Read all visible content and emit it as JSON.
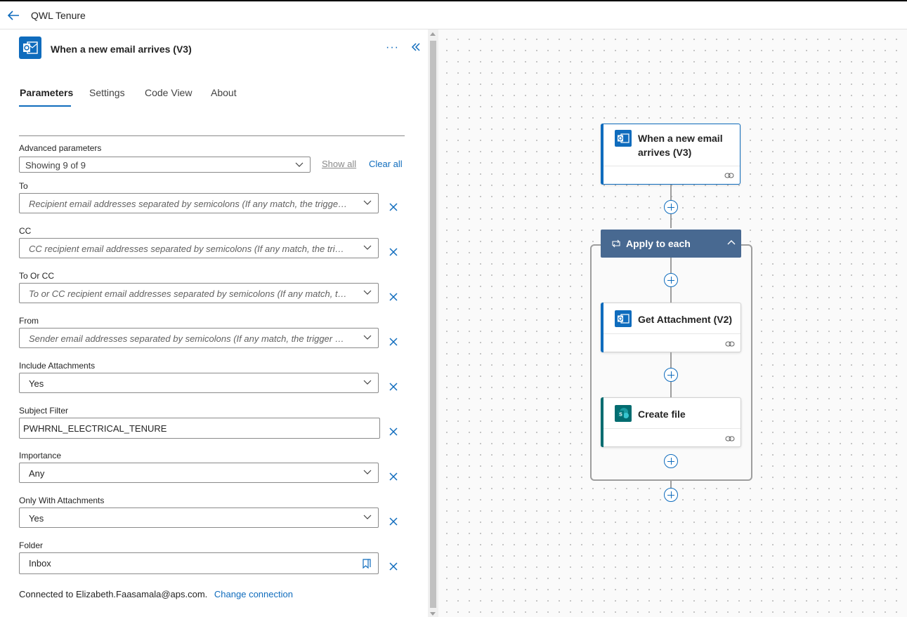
{
  "header": {
    "title": "QWL Tenure"
  },
  "panel": {
    "title": "When a new email arrives (V3)",
    "more": "···",
    "tabs": [
      {
        "label": "Parameters"
      },
      {
        "label": "Settings"
      },
      {
        "label": "Code View"
      },
      {
        "label": "About"
      }
    ],
    "advanced": {
      "label": "Advanced parameters",
      "value": "Showing 9 of 9",
      "show_all": "Show all",
      "clear_all": "Clear all"
    },
    "fields": [
      {
        "label": "To",
        "value": "Recipient email addresses separated by semicolons (If any match, the trigger will run)"
      },
      {
        "label": "CC",
        "value": "CC recipient email addresses separated by semicolons (If any match, the trigger will run)"
      },
      {
        "label": "To Or CC",
        "value": "To or CC recipient email addresses separated by semicolons (If any match, the trigger will run)"
      },
      {
        "label": "From",
        "value": "Sender email addresses separated by semicolons (If any match, the trigger will run)"
      },
      {
        "label": "Include Attachments",
        "value": "Yes"
      },
      {
        "label": "Subject Filter",
        "value": "PWHRNL_ELECTRICAL_TENURE"
      },
      {
        "label": "Importance",
        "value": "Any"
      },
      {
        "label": "Only With Attachments",
        "value": "Yes"
      },
      {
        "label": "Folder",
        "value": "Inbox"
      }
    ],
    "connection": {
      "text": "Connected to Elizabeth.Faasamala@aps.com.",
      "link": "Change connection"
    }
  },
  "flow": {
    "trigger": {
      "title_line1": "When a new email",
      "title_line2": "arrives (V3)"
    },
    "scope": {
      "title": "Apply to each"
    },
    "actions": [
      {
        "title": "Get Attachment (V2)"
      },
      {
        "title": "Create file"
      }
    ]
  },
  "colors": {
    "accent": "#0f6cbd",
    "outlook": "#0f6cbd",
    "sharepoint": "#036c70",
    "scope_header": "#486991"
  }
}
